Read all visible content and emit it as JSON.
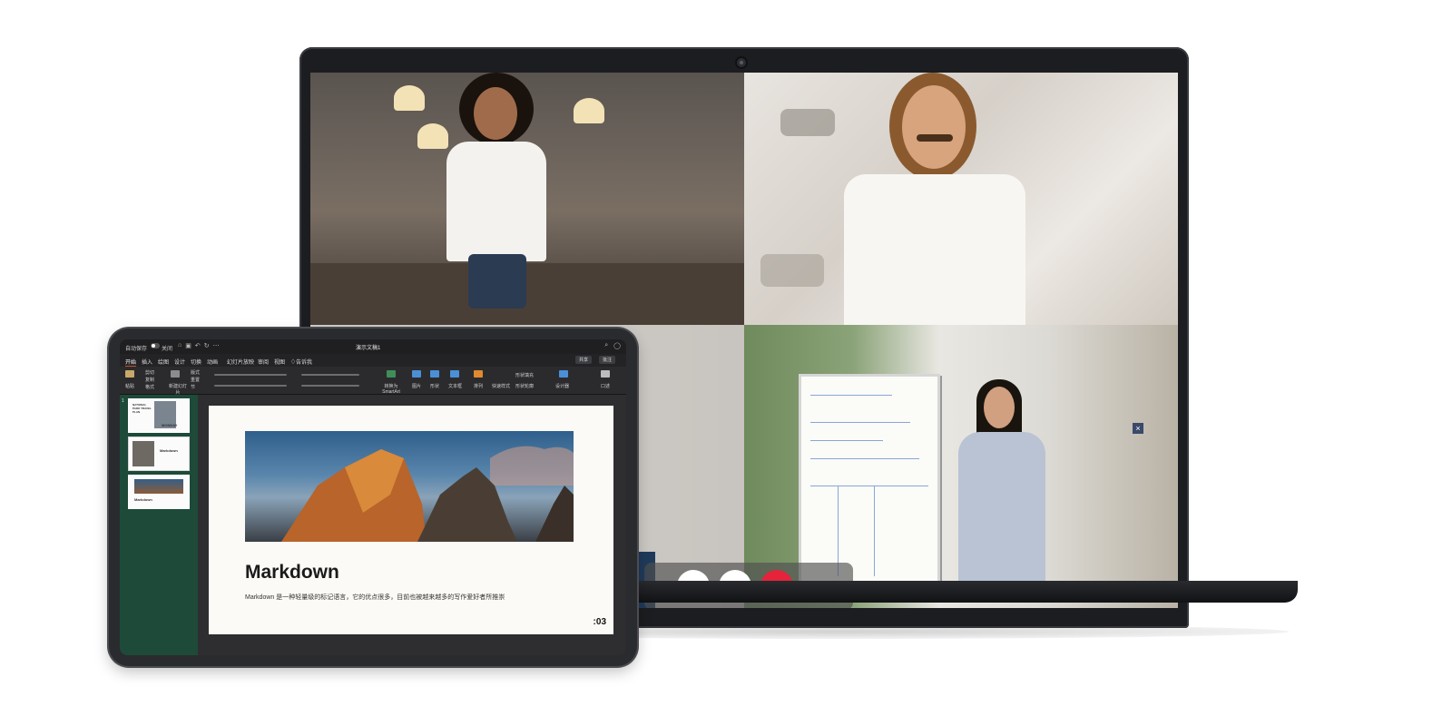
{
  "video_call": {
    "controls": {
      "mic_icon": "microphone-icon",
      "camera_icon": "video-camera-icon",
      "end_call_icon": "phone-hangup-icon",
      "end_call_color": "#e5233a"
    },
    "minimize_label": "×"
  },
  "ppt": {
    "titlebar": {
      "autosave": "自动保存",
      "toggle_state": "关闭",
      "doc_title": "演示文稿1"
    },
    "tabs": [
      "开始",
      "插入",
      "绘图",
      "设计",
      "切换",
      "动画",
      "幻灯片放映",
      "审阅",
      "视图",
      "告诉我"
    ],
    "share_label": "共享",
    "comment_label": "批注",
    "ribbon": {
      "paste": "粘贴",
      "cut": "剪切",
      "copy": "复制",
      "format": "格式",
      "new_slide": "新建幻灯片",
      "layout": "版式",
      "reset": "重置",
      "section": "节",
      "convert_smartart": "转换为SmartArt",
      "picture": "图片",
      "shape": "形状",
      "textbox": "文本框",
      "arrange": "排列",
      "quick_styles": "快速样式",
      "shape_fill": "形状填充",
      "shape_outline": "形状轮廓",
      "designer": "设计器",
      "dictate": "口述"
    },
    "thumbnails": [
      {
        "num": "1",
        "title": "MONDAY",
        "subtitle": "NATIONAL PARK TRAVEL PLAN"
      },
      {
        "num": "",
        "title": "Markdown",
        "subtitle": ""
      },
      {
        "num": "",
        "title": "Markdown",
        "subtitle": ""
      }
    ],
    "slide": {
      "title": "Markdown",
      "body": "Markdown 是一种轻量级的标记语言，它的优点很多，目前也被越来越多的写作爱好者所推崇",
      "number": ":03"
    }
  }
}
